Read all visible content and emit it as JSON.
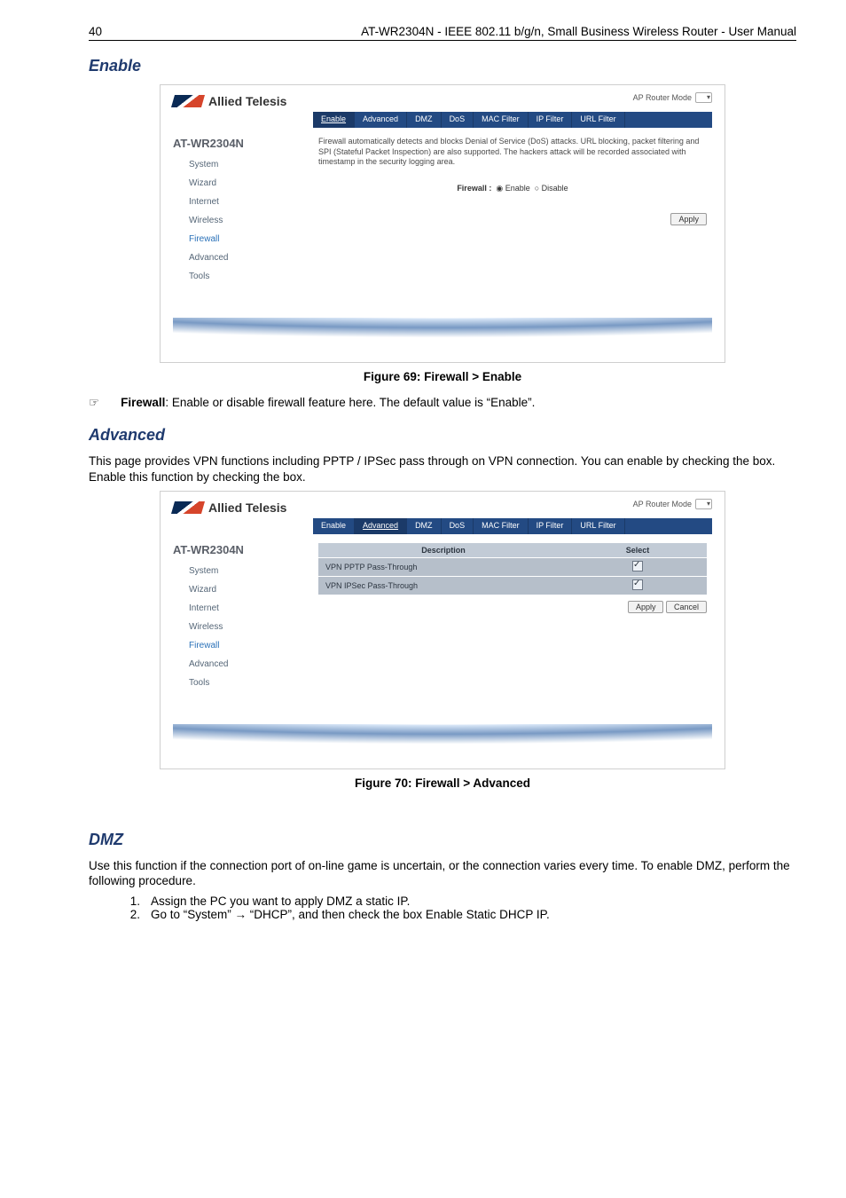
{
  "header": {
    "page_no": "40",
    "title": "AT-WR2304N - IEEE 802.11 b/g/n, Small Business Wireless Router - User Manual"
  },
  "sections": {
    "enable": {
      "heading": "Enable"
    },
    "advanced": {
      "heading": "Advanced",
      "body": "This page provides VPN functions including PPTP / IPSec pass through on VPN connection. You can enable by checking the box. Enable this function by checking the box."
    },
    "dmz": {
      "heading": "DMZ",
      "body": "Use this function if the connection port of on-line game is uncertain, or the connection varies every time. To enable DMZ, perform the following procedure.",
      "steps": [
        "Assign the PC you want to apply DMZ a static IP.",
        "Go to “System” → “DHCP”, and then check the box Enable Static DHCP IP."
      ]
    }
  },
  "captions": {
    "fig69": "Figure 69: Firewall > Enable",
    "fig70": "Figure 70: Firewall > Advanced"
  },
  "bullet": {
    "firewall_label": "Firewall",
    "firewall_text": ": Enable or disable firewall feature here. The default value is “Enable”."
  },
  "shot_common": {
    "brand": "Allied Telesis",
    "model": "AT-WR2304N",
    "mode_label": "AP Router Mode",
    "nav": [
      "System",
      "Wizard",
      "Internet",
      "Wireless",
      "Firewall",
      "Advanced",
      "Tools"
    ]
  },
  "shot1": {
    "tabs": [
      "Enable",
      "Advanced",
      "DMZ",
      "DoS",
      "MAC Filter",
      "IP Filter",
      "URL Filter"
    ],
    "active_tab": "Enable",
    "desc": "Firewall automatically detects and blocks Denial of Service (DoS) attacks. URL blocking, packet filtering and SPI (Stateful Packet Inspection) are also supported. The hackers attack will be recorded associated with timestamp in the security logging area.",
    "row_label": "Firewall :",
    "opt_enable": "Enable",
    "opt_disable": "Disable",
    "apply": "Apply"
  },
  "shot2": {
    "tabs": [
      "Enable",
      "Advanced",
      "DMZ",
      "DoS",
      "MAC Filter",
      "IP Filter",
      "URL Filter"
    ],
    "active_tab": "Advanced",
    "col_desc": "Description",
    "col_sel": "Select",
    "rows": [
      "VPN PPTP Pass-Through",
      "VPN IPSec Pass-Through"
    ],
    "apply": "Apply",
    "cancel": "Cancel"
  }
}
